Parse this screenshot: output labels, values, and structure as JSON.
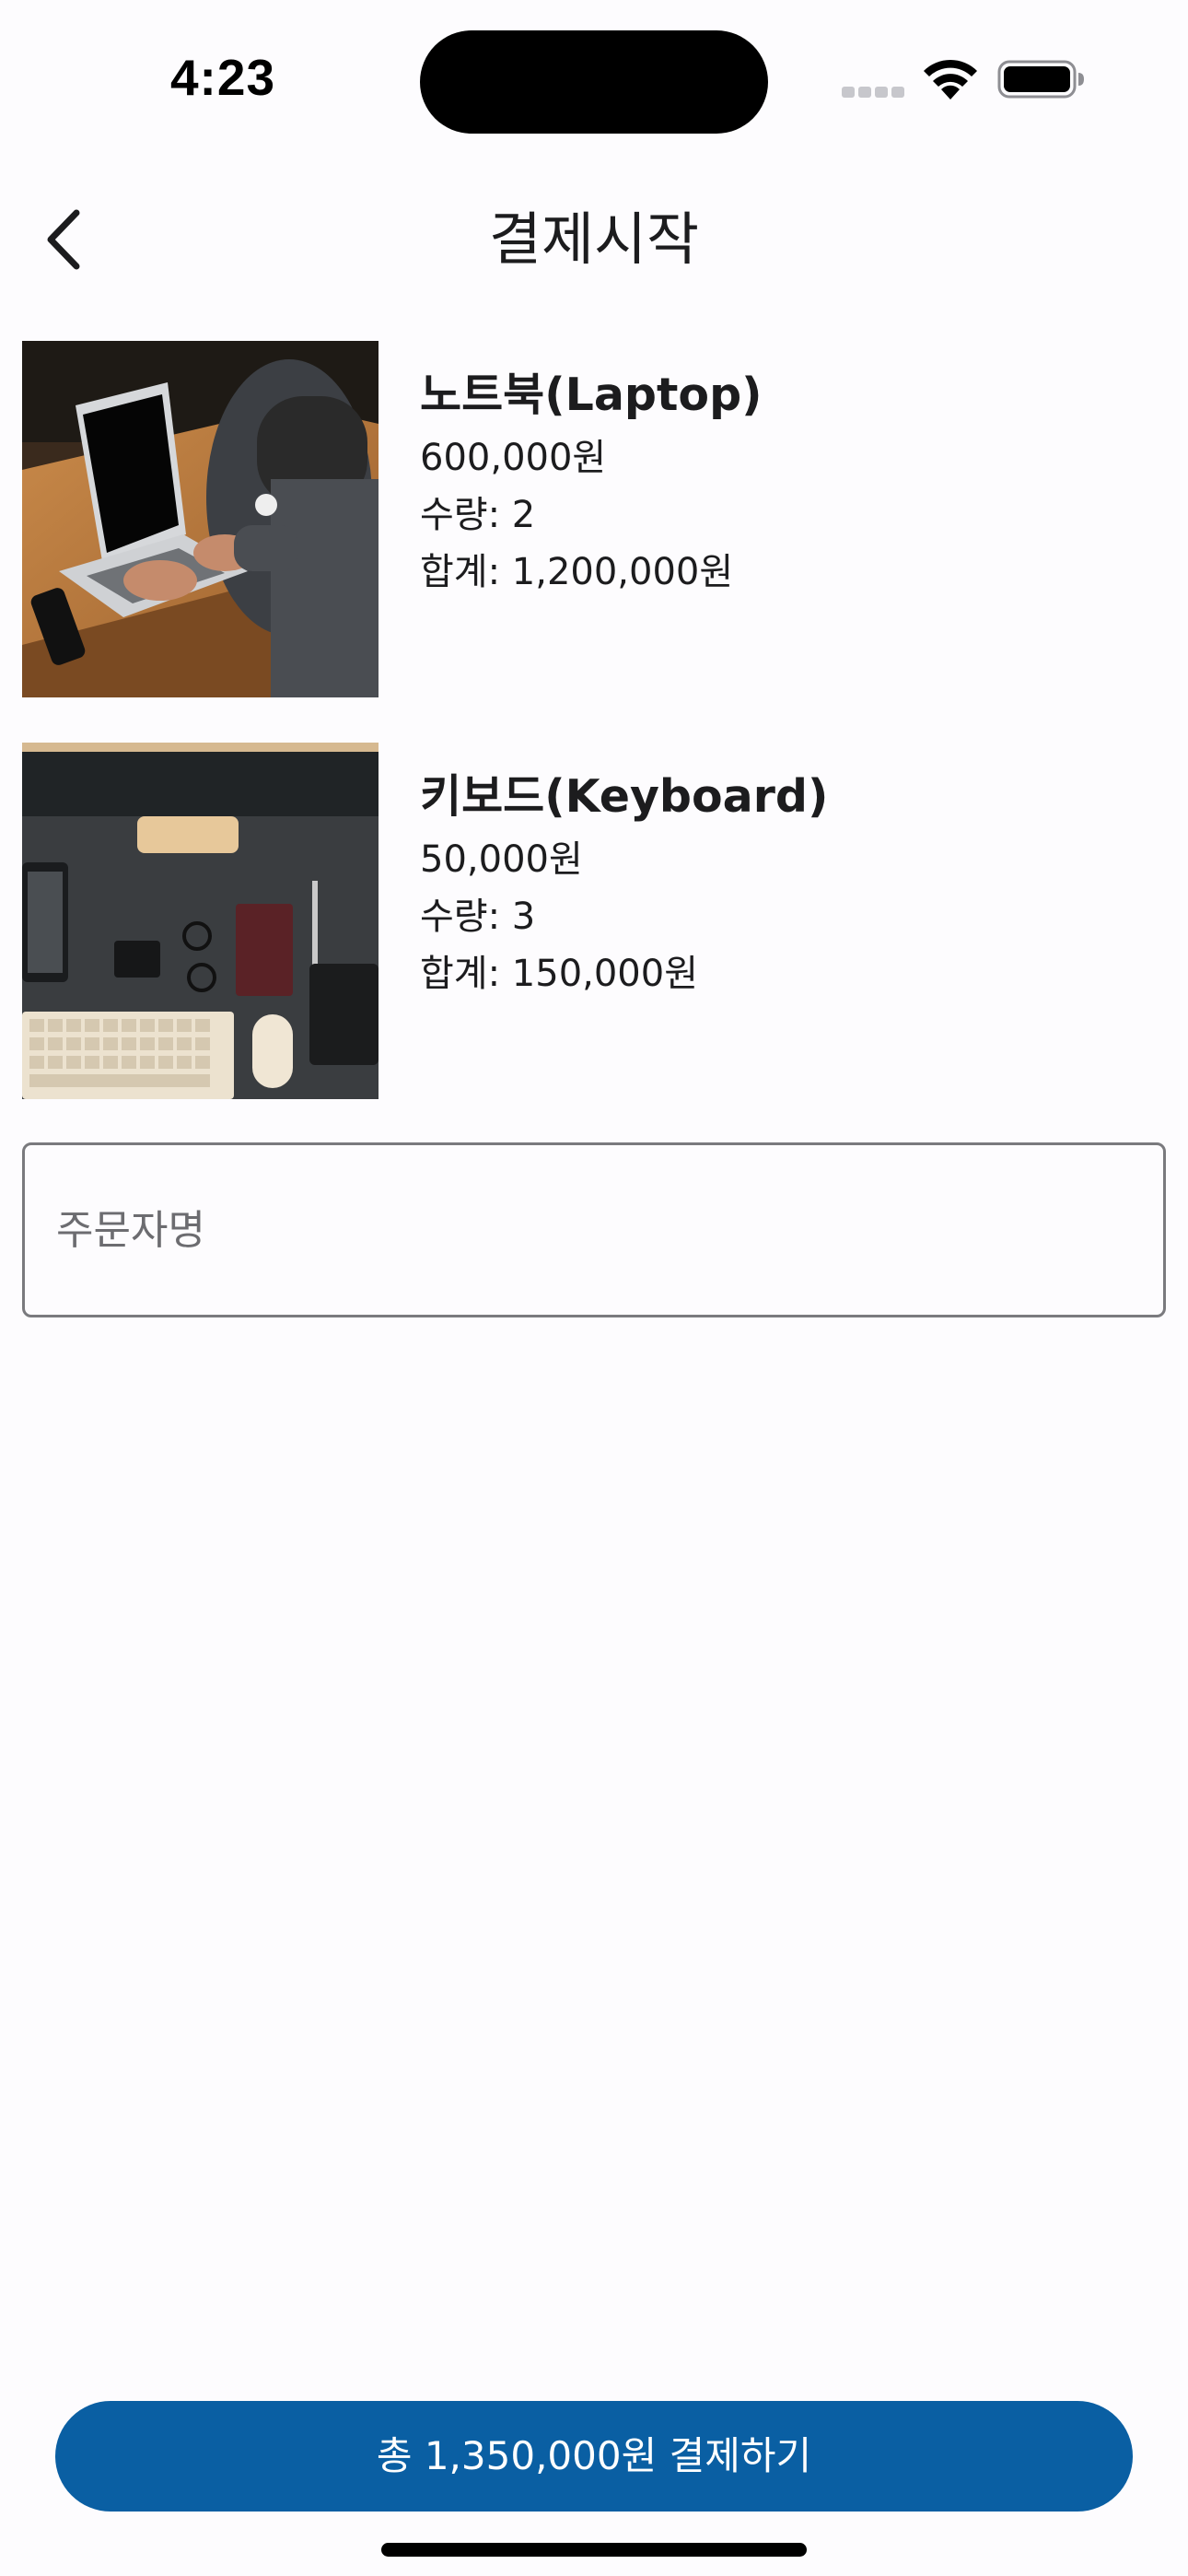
{
  "status_bar": {
    "time": "4:23"
  },
  "header": {
    "title": "결제시작",
    "back_icon": "chevron-left-icon"
  },
  "cart": {
    "items": [
      {
        "name": "노트북(Laptop)",
        "price": "600,000원",
        "quantity": "수량: 2",
        "subtotal": "합계: 1,200,000원",
        "image": "laptop-photo"
      },
      {
        "name": "키보드(Keyboard)",
        "price": "50,000원",
        "quantity": "수량: 3",
        "subtotal": "합계: 150,000원",
        "image": "keyboard-photo"
      }
    ]
  },
  "order_form": {
    "orderer_name_placeholder": "주문자명",
    "orderer_name_value": ""
  },
  "footer": {
    "pay_button_label": "총 1,350,000원 결제하기"
  },
  "colors": {
    "background": "#fdfcfe",
    "primary": "#0a5fa3",
    "text": "#1c1c1e",
    "field_border": "#7a7a7e"
  }
}
